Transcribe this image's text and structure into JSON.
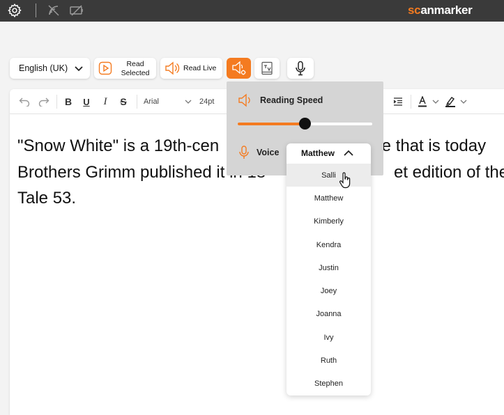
{
  "topbar": {
    "brand_sc": "sc",
    "brand_rest": "anmarker",
    "icons": [
      "gear-icon",
      "no-signal-icon",
      "no-battery-icon"
    ]
  },
  "toolbar": {
    "language": "English (UK)",
    "read_selected_line1": "Read",
    "read_selected_line2": "Selected",
    "read_live": "Read Live"
  },
  "editor_toolbar": {
    "font": "Arial",
    "size": "24pt"
  },
  "document": {
    "line1": "\"Snow White\" is a 19th-cen",
    "line1b": "ale that is today",
    "line2": "Brothers Grimm published it in 18",
    "line2b": "et edition of their",
    "line3": "Tale 53."
  },
  "reading_panel": {
    "speed_label": "Reading Speed",
    "speed_value": 0.5,
    "voice_label": "Voice"
  },
  "voice_dropdown": {
    "selected": "Matthew",
    "hovered": "Salli",
    "options": [
      "Salli",
      "Matthew",
      "Kimberly",
      "Kendra",
      "Justin",
      "Joey",
      "Joanna",
      "Ivy",
      "Ruth",
      "Stephen"
    ]
  },
  "colors": {
    "accent": "#f47b20",
    "topbar": "#3a3a3a",
    "panel": "#d5d5d5"
  }
}
